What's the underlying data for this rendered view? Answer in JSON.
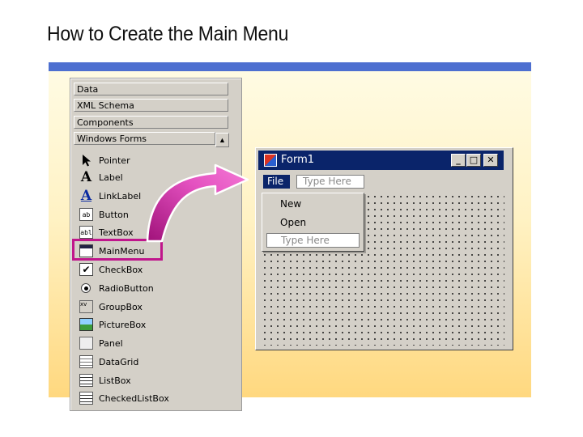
{
  "slide": {
    "title": "How to Create the Main Menu"
  },
  "colors": {
    "accent_bar": "#4d6fd0",
    "highlight": "#c0168c",
    "titlebar": "#0a246a",
    "arrow": "#d43aa8"
  },
  "toolbox": {
    "tabs": [
      "Data",
      "XML Schema",
      "Components",
      "Windows Forms"
    ],
    "scroll_up_icon": "▲",
    "items": [
      {
        "label": "Pointer",
        "icon": "pointer-arrow-icon"
      },
      {
        "label": "Label",
        "icon": "label-icon",
        "glyph": "A"
      },
      {
        "label": "LinkLabel",
        "icon": "linklabel-icon",
        "glyph": "A"
      },
      {
        "label": "Button",
        "icon": "button-icon",
        "glyph": "ab"
      },
      {
        "label": "TextBox",
        "icon": "textbox-icon",
        "glyph": "abl"
      },
      {
        "label": "MainMenu",
        "icon": "mainmenu-icon"
      },
      {
        "label": "CheckBox",
        "icon": "checkbox-icon",
        "glyph": "✔"
      },
      {
        "label": "RadioButton",
        "icon": "radiobutton-icon"
      },
      {
        "label": "GroupBox",
        "icon": "groupbox-icon",
        "glyph": "xv"
      },
      {
        "label": "PictureBox",
        "icon": "picturebox-icon"
      },
      {
        "label": "Panel",
        "icon": "panel-icon"
      },
      {
        "label": "DataGrid",
        "icon": "datagrid-icon"
      },
      {
        "label": "ListBox",
        "icon": "listbox-icon"
      },
      {
        "label": "CheckedListBox",
        "icon": "checkedlistbox-icon"
      }
    ],
    "selected": "MainMenu"
  },
  "form": {
    "title": "Form1",
    "controls": {
      "minimize": "_",
      "maximize": "□",
      "close": "✕"
    },
    "menubar": {
      "file": "File",
      "type_here": "Type Here"
    },
    "dropdown": {
      "items": [
        "New",
        "Open"
      ],
      "type_here": "Type Here"
    }
  }
}
